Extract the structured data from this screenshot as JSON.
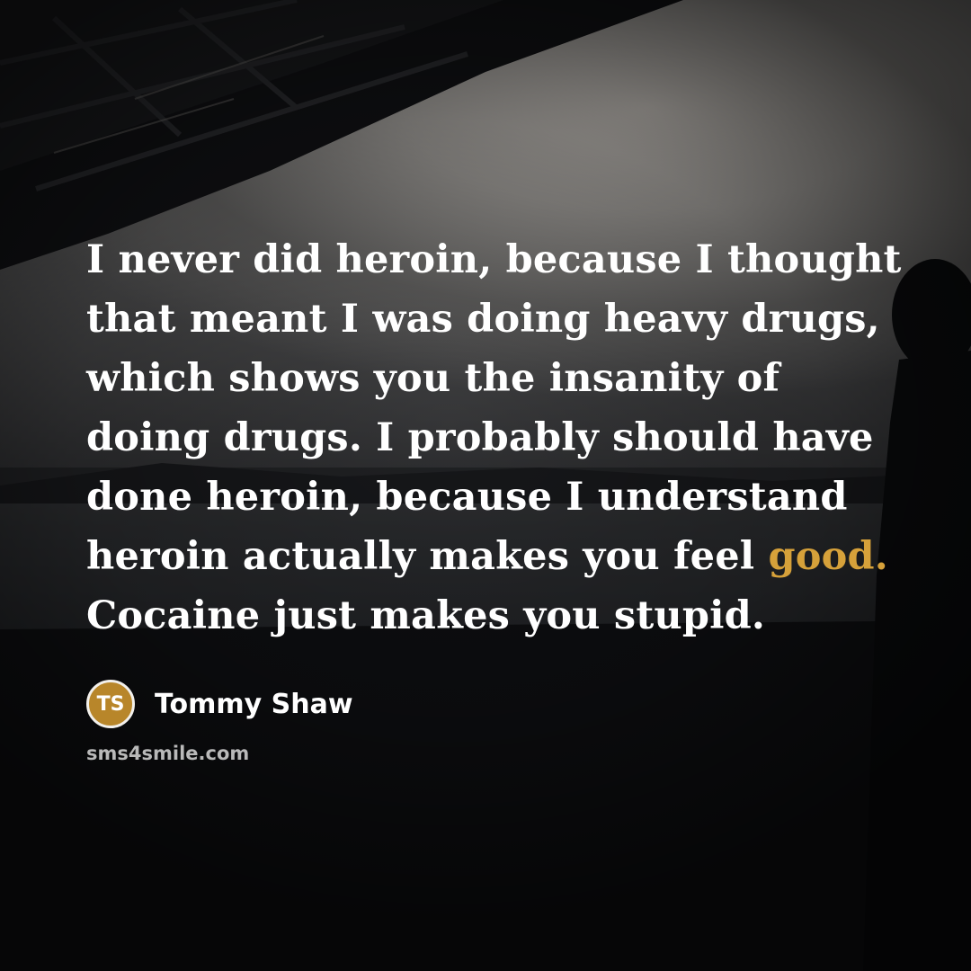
{
  "quote": {
    "lines": [
      "I never did heroin, because I thought",
      "that meant I was doing heavy drugs,",
      "which shows you the insanity of",
      "doing drugs. I probably should have",
      "done heroin, because I understand",
      "heroin actually makes you feel ",
      "Cocaine just makes you stupid."
    ],
    "highlight_word": "good.",
    "highlight_color": "#d6a13a"
  },
  "author": {
    "initials": "TS",
    "name": "Tommy Shaw",
    "avatar_color": "#b8862a"
  },
  "site": "sms4smile.com"
}
